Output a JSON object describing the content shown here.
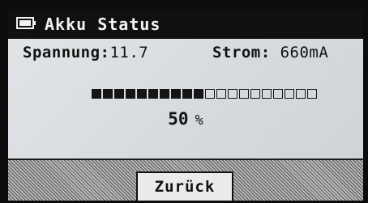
{
  "title_bar": {
    "icon": "battery-icon",
    "title": "Akku Status"
  },
  "readout": {
    "voltage_label": "Spannung:",
    "voltage_value": "11.7",
    "current_label": "Strom:",
    "current_value": "660mA"
  },
  "battery_bar": {
    "total_segments": 20,
    "filled_segments": 10
  },
  "charge": {
    "value": "50",
    "unit": "%"
  },
  "footer": {
    "back_label": "Zurück"
  },
  "colors": {
    "title_background": "#101010",
    "screen_background": "#dcdfe2",
    "segment_fill": "#151515"
  }
}
